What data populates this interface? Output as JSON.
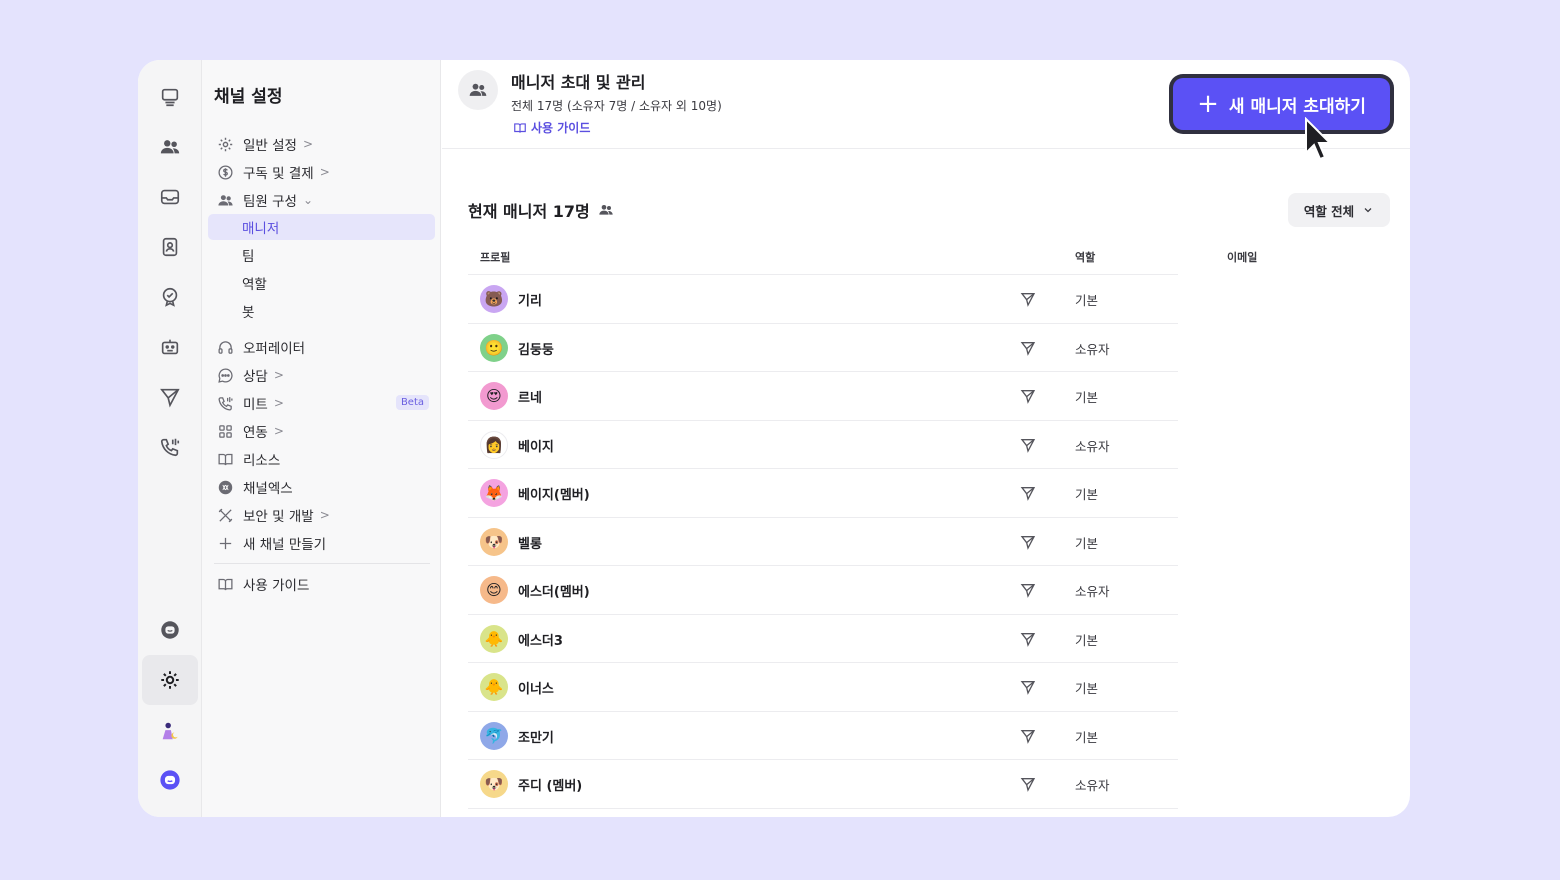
{
  "sidebar": {
    "title": "채널 설정",
    "items": [
      {
        "label": "일반 설정",
        "icon": "gear-icon",
        "chevron": ">"
      },
      {
        "label": "구독 및 결제",
        "icon": "dollar-icon",
        "chevron": ">"
      },
      {
        "label": "팀원 구성",
        "icon": "people-icon",
        "chevron": "⌄"
      },
      {
        "label": "매니저"
      },
      {
        "label": "팀"
      },
      {
        "label": "역할"
      },
      {
        "label": "봇"
      },
      {
        "label": "오퍼레이터",
        "icon": "headset-icon"
      },
      {
        "label": "상담",
        "icon": "chat-bubble-icon",
        "chevron": ">"
      },
      {
        "label": "미트",
        "icon": "phone-icon",
        "chevron": ">",
        "badge": "Beta"
      },
      {
        "label": "연동",
        "icon": "grid-icon",
        "chevron": ">"
      },
      {
        "label": "리소스",
        "icon": "book-icon"
      },
      {
        "label": "채널엑스",
        "icon": "channelx-icon"
      },
      {
        "label": "보안 및 개발",
        "icon": "tools-icon",
        "chevron": ">"
      },
      {
        "label": "새 채널 만들기",
        "icon": "plus-icon"
      }
    ],
    "guide": "사용 가이드"
  },
  "header": {
    "title": "매니저 초대 및 관리",
    "subtitle": "전체 17명 (소유자 7명 / 소유자 외 10명)",
    "guide_link": "사용 가이드",
    "invite_button": "새 매니저 초대하기",
    "invite_plus": "+"
  },
  "section": {
    "title": "현재 매니저 17명",
    "role_filter": "역할 전체"
  },
  "table": {
    "columns": {
      "profile": "프로필",
      "role": "역할",
      "email": "이메일"
    },
    "rows": [
      {
        "name": "기리",
        "role": "기본",
        "avatar": "🐻",
        "color": "#c9a6f2"
      },
      {
        "name": "김둥둥",
        "role": "소유자",
        "avatar": "🙂",
        "color": "#7fd18a"
      },
      {
        "name": "르네",
        "role": "기본",
        "avatar": "😍",
        "color": "#f29ad0"
      },
      {
        "name": "베이지",
        "role": "소유자",
        "avatar": "👩",
        "color": "#ffffff"
      },
      {
        "name": "베이지(멤버)",
        "role": "기본",
        "avatar": "🦊",
        "color": "#f4a3e0"
      },
      {
        "name": "벨롱",
        "role": "기본",
        "avatar": "🐶",
        "color": "#f6c48a"
      },
      {
        "name": "에스더(멤버)",
        "role": "소유자",
        "avatar": "😊",
        "color": "#f6b98a"
      },
      {
        "name": "에스더3",
        "role": "기본",
        "avatar": "🐥",
        "color": "#d9e48a"
      },
      {
        "name": "이너스",
        "role": "기본",
        "avatar": "🐥",
        "color": "#d9e48a"
      },
      {
        "name": "조만기",
        "role": "기본",
        "avatar": "🐬",
        "color": "#8fa8e8"
      },
      {
        "name": "주디 (멤버)",
        "role": "소유자",
        "avatar": "🐶",
        "color": "#f6d88a"
      }
    ]
  },
  "colors": {
    "accent": "#5b51f5",
    "selected_bg": "#e6e5fb"
  }
}
